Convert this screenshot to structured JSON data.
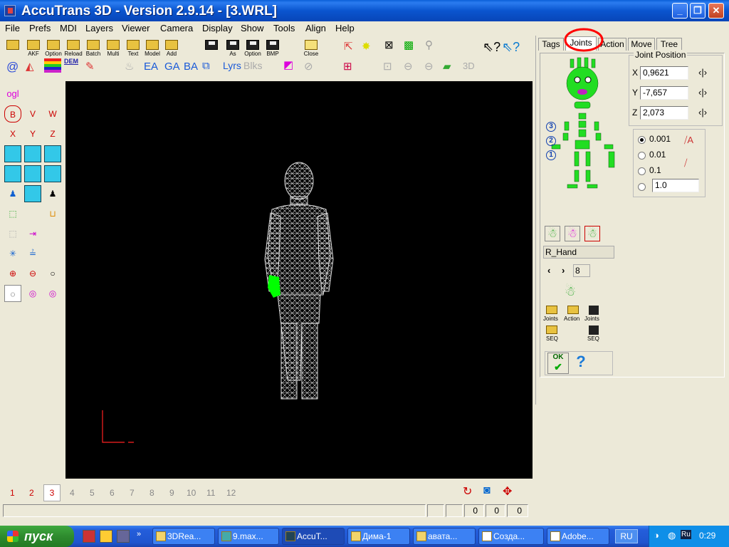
{
  "window": {
    "title": "AccuTrans 3D - Version 2.9.14 - [3.WRL]"
  },
  "menu": [
    "File",
    "Prefs",
    "MDI",
    "Layers",
    "Viewer",
    "Camera",
    "Display",
    "Show",
    "Tools",
    "Align",
    "Help"
  ],
  "toolbar": {
    "row1_labels": [
      "AKF",
      "Option",
      "Reload",
      "Batch",
      "Multi",
      "Text",
      "Model",
      "Add",
      "As",
      "Option",
      "BMP",
      "Close"
    ],
    "row2_text": [
      "@",
      "DEM",
      "EA",
      "GA",
      "BA",
      "Lyrs",
      "Blks",
      "3D"
    ]
  },
  "palette": {
    "title": "ogl",
    "labels": [
      "B",
      "V",
      "W",
      "X",
      "Y",
      "Z"
    ]
  },
  "pages": {
    "numbers": [
      "1",
      "2",
      "3",
      "4",
      "5",
      "6",
      "7",
      "8",
      "9",
      "10",
      "11",
      "12"
    ],
    "active": "3"
  },
  "status": {
    "values": [
      "0",
      "0",
      "0"
    ]
  },
  "panel": {
    "tabs": [
      "Tags",
      "Joints",
      "Action",
      "Move",
      "Tree"
    ],
    "active_tab": "Joints",
    "joint_position": {
      "title": "Joint Position",
      "x_label": "X",
      "x": "0,9621",
      "y_label": "Y",
      "y": "-7,657",
      "z_label": "Z",
      "z": "2,073"
    },
    "precision": {
      "options": [
        "0.001",
        "0.01",
        "0.1"
      ],
      "custom": "1.0",
      "selected": "0.001"
    },
    "levels": [
      "3",
      "2",
      "1"
    ],
    "joint_name": "R_Hand",
    "joint_index": "8",
    "file_buttons": [
      {
        "label": "Joints"
      },
      {
        "label": "Action"
      },
      {
        "label": "Joints"
      },
      {
        "label": "SEQ"
      },
      {
        "label": "SEQ"
      }
    ],
    "ok_label": "OK",
    "help_glyph": "?"
  },
  "taskbar": {
    "start": "пуск",
    "tasks": [
      "3DRea...",
      "9.max...",
      "AccuT...",
      "Дима-1",
      "авата...",
      "Созда...",
      "Adobe..."
    ],
    "active_task": "AccuT...",
    "lang": "RU",
    "clock": "0:29"
  },
  "colors": {
    "titlebar": "#0a55cf",
    "viewport": "#000000",
    "selection": "#00ff00",
    "skeleton": "#22dd22",
    "highlight_circle": "#ff0000"
  }
}
